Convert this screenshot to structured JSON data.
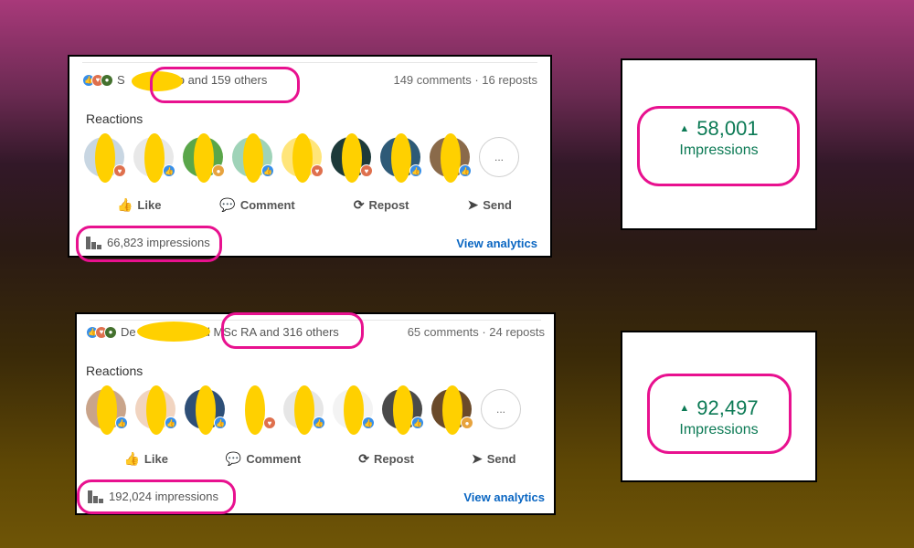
{
  "posts": [
    {
      "reactions_summary": "S",
      "reactions_summary_tail": "ejo and 159 others",
      "comments_reposts": "149 comments · 16 reposts",
      "reactions_label": "Reactions",
      "more_label": "...",
      "actions": [
        "Like",
        "Comment",
        "Repost",
        "Send"
      ],
      "impressions": "66,823 impressions",
      "view_analytics": "View analytics"
    },
    {
      "reactions_summary": "De",
      "reactions_summary_tail": "d MSc RA and 316 others",
      "comments_reposts": "65 comments · 24 reposts",
      "reactions_label": "Reactions",
      "more_label": "...",
      "actions": [
        "Like",
        "Comment",
        "Repost",
        "Send"
      ],
      "impressions": "192,024 impressions",
      "view_analytics": "View analytics"
    }
  ],
  "stats": [
    {
      "value": "58,001",
      "label": "Impressions",
      "trend_icon": "up-triangle"
    },
    {
      "value": "92,497",
      "label": "Impressions",
      "trend_icon": "up-triangle"
    }
  ],
  "colors": {
    "highlight": "#e8118f",
    "redaction": "#ffd000",
    "link": "#0a66c2",
    "positive": "#0c7a55"
  }
}
